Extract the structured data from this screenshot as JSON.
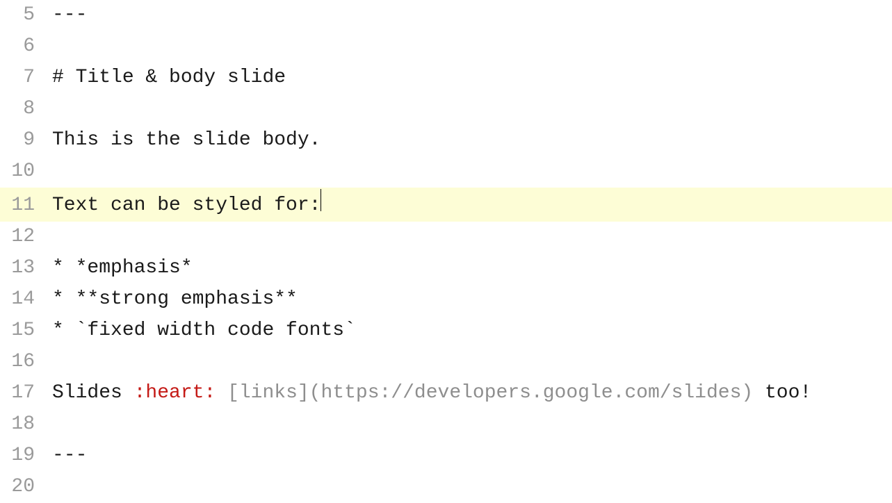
{
  "editor": {
    "activeLine": 11,
    "lines": [
      {
        "num": 5,
        "tokens": [
          {
            "cls": "tok-plain",
            "text": "---"
          }
        ]
      },
      {
        "num": 6,
        "tokens": []
      },
      {
        "num": 7,
        "tokens": [
          {
            "cls": "tok-plain",
            "text": "# Title & body slide"
          }
        ]
      },
      {
        "num": 8,
        "tokens": []
      },
      {
        "num": 9,
        "tokens": [
          {
            "cls": "tok-plain",
            "text": "This is the slide body."
          }
        ]
      },
      {
        "num": 10,
        "tokens": []
      },
      {
        "num": 11,
        "tokens": [
          {
            "cls": "tok-plain",
            "text": "Text can be styled for:"
          }
        ],
        "cursorAfter": true
      },
      {
        "num": 12,
        "tokens": []
      },
      {
        "num": 13,
        "tokens": [
          {
            "cls": "tok-plain",
            "text": "* *emphasis*"
          }
        ]
      },
      {
        "num": 14,
        "tokens": [
          {
            "cls": "tok-plain",
            "text": "* **strong emphasis**"
          }
        ]
      },
      {
        "num": 15,
        "tokens": [
          {
            "cls": "tok-plain",
            "text": "* `fixed width code fonts`"
          }
        ]
      },
      {
        "num": 16,
        "tokens": []
      },
      {
        "num": 17,
        "tokens": [
          {
            "cls": "tok-plain",
            "text": "Slides "
          },
          {
            "cls": "tok-emoji",
            "text": ":heart:"
          },
          {
            "cls": "tok-plain",
            "text": " "
          },
          {
            "cls": "tok-link",
            "text": "[links](https://developers.google.com/slides)"
          },
          {
            "cls": "tok-plain",
            "text": " too!"
          }
        ]
      },
      {
        "num": 18,
        "tokens": []
      },
      {
        "num": 19,
        "tokens": [
          {
            "cls": "tok-plain",
            "text": "---"
          }
        ]
      },
      {
        "num": 20,
        "tokens": []
      }
    ]
  }
}
